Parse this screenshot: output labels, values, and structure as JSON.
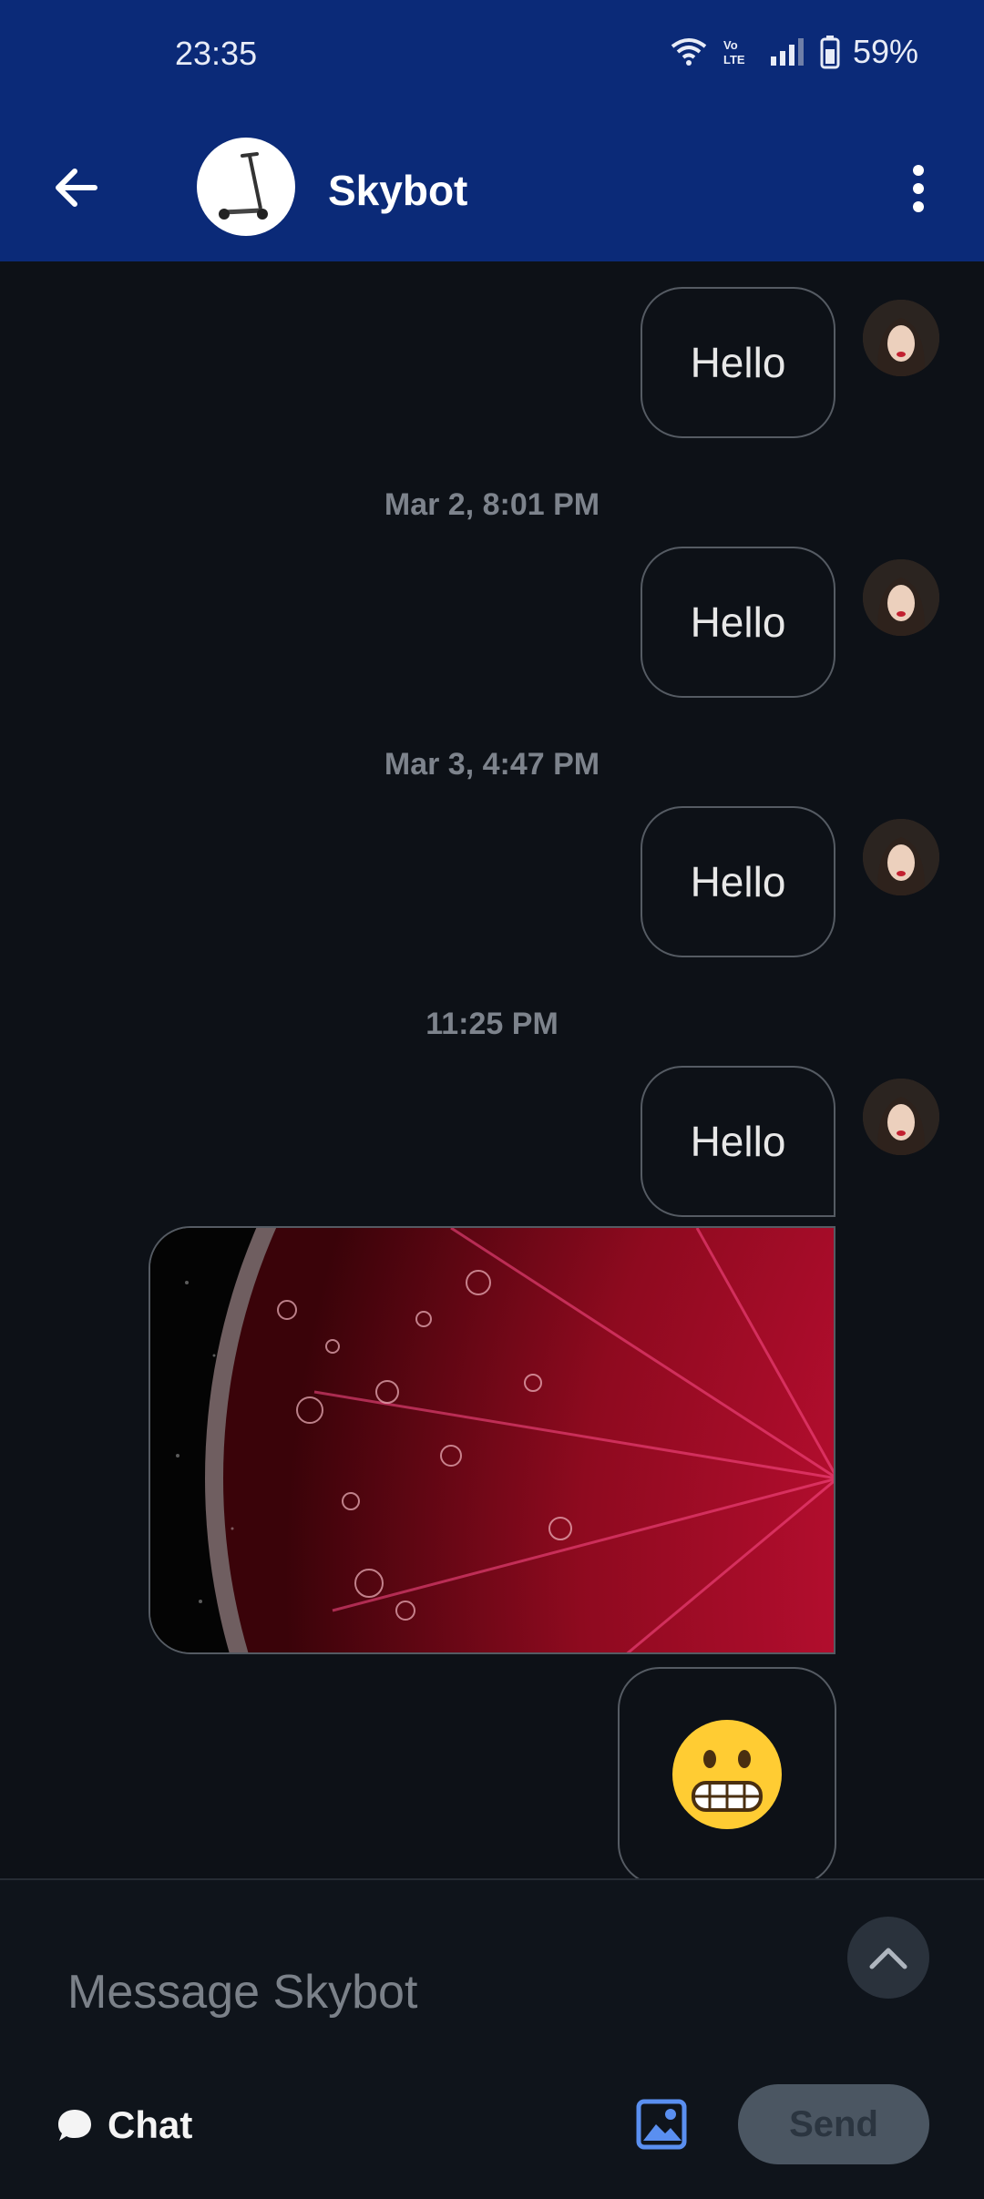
{
  "status_bar": {
    "time": "23:35",
    "battery": "59%",
    "icons": [
      "wifi-icon",
      "volte-icon",
      "signal-icon",
      "battery-icon"
    ]
  },
  "header": {
    "title": "Skybot",
    "back_icon": "arrow-left-icon",
    "menu_icon": "more-vertical-icon",
    "avatar": "scooter-avatar"
  },
  "messages": [
    {
      "text": "Hello"
    },
    {
      "timestamp": "Mar 2, 8:01 PM",
      "text": "Hello"
    },
    {
      "timestamp": "Mar 3, 4:47 PM",
      "text": "Hello"
    },
    {
      "timestamp": "11:25 PM",
      "text": "Hello"
    }
  ],
  "image_message": {
    "kind": "photo-red-citrus-slice-with-bubbles"
  },
  "emoji_message": {
    "emoji": "😬"
  },
  "composer": {
    "placeholder": "Message Skybot",
    "value": "",
    "mode_label": "Chat",
    "send_label": "Send",
    "expand_icon": "chevron-up-icon",
    "image_icon": "image-icon",
    "chat_icon": "chat-bubble-icon"
  },
  "colors": {
    "header": "#0b2a78",
    "background": "#0d1117",
    "bubble_border": "#555b63",
    "accent": "#5a8ff0"
  }
}
